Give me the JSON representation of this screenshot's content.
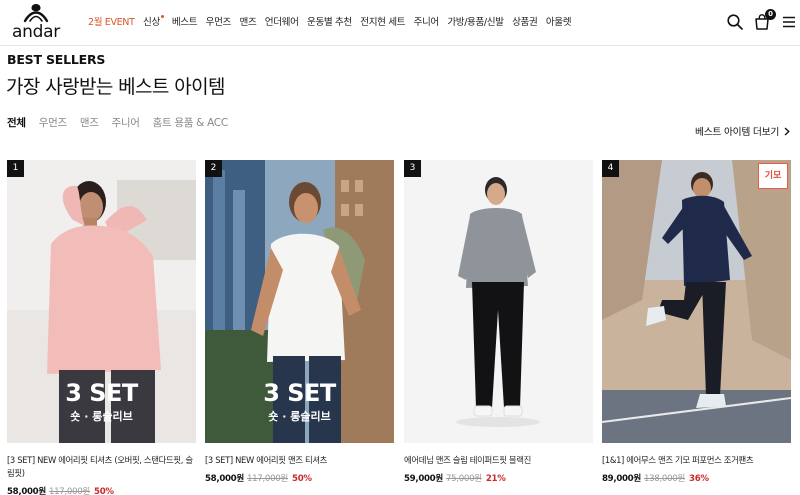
{
  "brand": {
    "name": "andar"
  },
  "nav": [
    {
      "label": "2월 EVENT",
      "highlight": true,
      "dot": false
    },
    {
      "label": "신상",
      "highlight": false,
      "dot": true
    },
    {
      "label": "베스트",
      "highlight": false,
      "dot": false
    },
    {
      "label": "우먼즈",
      "highlight": false,
      "dot": false
    },
    {
      "label": "맨즈",
      "highlight": false,
      "dot": false
    },
    {
      "label": "언더웨어",
      "highlight": false,
      "dot": false
    },
    {
      "label": "운동별 추천",
      "highlight": false,
      "dot": false
    },
    {
      "label": "전지현 세트",
      "highlight": false,
      "dot": false
    },
    {
      "label": "주니어",
      "highlight": false,
      "dot": false
    },
    {
      "label": "가방/용품/신발",
      "highlight": false,
      "dot": false
    },
    {
      "label": "상품권",
      "highlight": false,
      "dot": false
    },
    {
      "label": "아울렛",
      "highlight": false,
      "dot": false
    }
  ],
  "header_icons": {
    "search": "search-icon",
    "bag": "shopping-bag-icon",
    "bag_count": "0",
    "menu": "hamburger-menu-icon"
  },
  "section": {
    "eyebrow": "BEST SELLERS",
    "title": "가장 사랑받는 베스트 아이템",
    "more_label": "베스트 아이템 더보기"
  },
  "tabs": [
    {
      "label": "전체",
      "active": true
    },
    {
      "label": "우먼즈",
      "active": false
    },
    {
      "label": "맨즈",
      "active": false
    },
    {
      "label": "주니어",
      "active": false
    },
    {
      "label": "홈트 용품 & ACC",
      "active": false
    }
  ],
  "products": [
    {
      "rank": "1",
      "set_big": "3 SET",
      "set_small": "숏 · 롱슬리브",
      "tag": "",
      "name": "[3 SET] NEW 에어리핏 티셔츠 (오버핏, 스탠다드핏, 슬림핏)",
      "price": "58,000원",
      "original_price": "117,000원",
      "discount": "50%"
    },
    {
      "rank": "2",
      "set_big": "3 SET",
      "set_small": "숏 · 롱슬리브",
      "tag": "",
      "name": "[3 SET] NEW 에어리핏 맨즈 티셔츠",
      "price": "58,000원",
      "original_price": "117,000원",
      "discount": "50%"
    },
    {
      "rank": "3",
      "set_big": "",
      "set_small": "",
      "tag": "",
      "name": "에어데님 맨즈 슬림 테이퍼드핏 블랙진",
      "price": "59,000원",
      "original_price": "75,000원",
      "discount": "21%"
    },
    {
      "rank": "4",
      "set_big": "",
      "set_small": "",
      "tag": "기모",
      "name": "[1&1] 에어무스 맨즈 기모 퍼포먼스 조거팬츠",
      "price": "89,000원",
      "original_price": "138,000원",
      "discount": "36%"
    }
  ],
  "colors": {
    "accent": "#d9582b",
    "discount": "#c92a2a",
    "text": "#111111"
  }
}
